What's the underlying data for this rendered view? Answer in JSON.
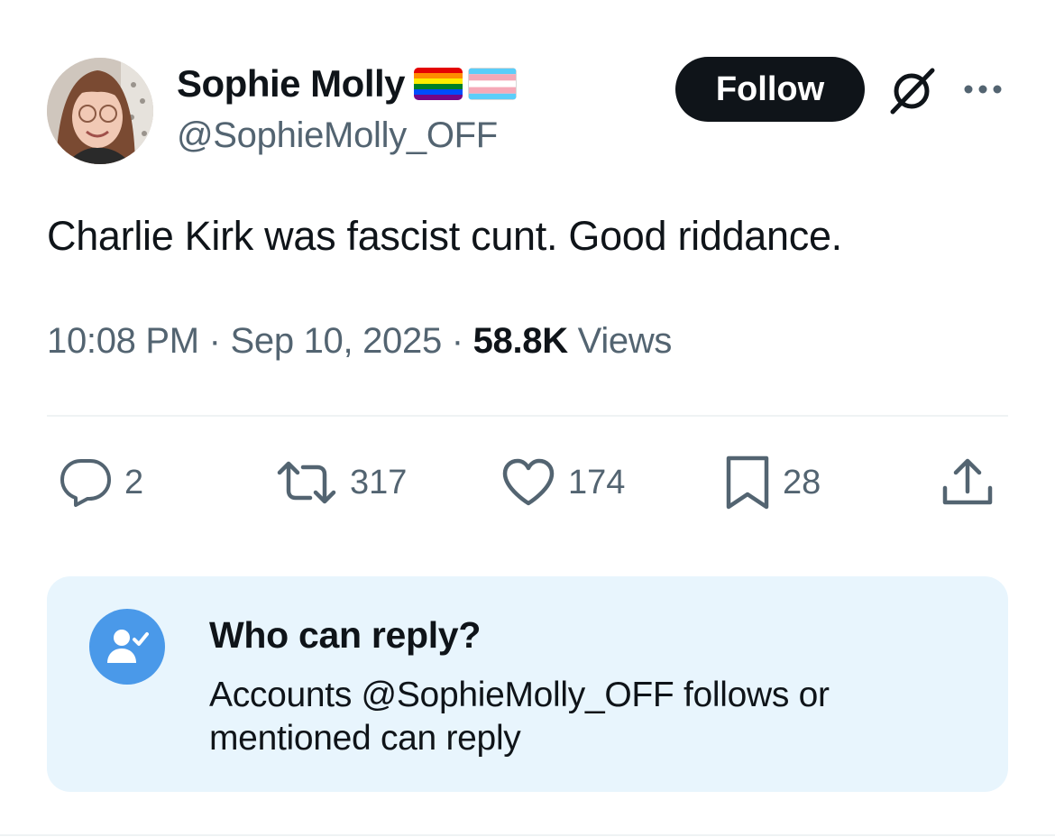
{
  "author": {
    "display_name": "Sophie Molly",
    "handle": "@SophieMolly_OFF",
    "flags": [
      "rainbow-pride-flag-emoji",
      "transgender-flag-emoji"
    ]
  },
  "header": {
    "follow_label": "Follow",
    "grok_icon": "grok-icon",
    "more_icon": "more-horizontal-icon"
  },
  "tweet": {
    "text": "Charlie Kirk was fascist cunt. Good riddance.",
    "time": "10:08 PM",
    "separator": "·",
    "date": "Sep 10, 2025",
    "views_count": "58.8K",
    "views_label": "Views"
  },
  "actions": {
    "replies": "2",
    "reposts": "317",
    "likes": "174",
    "bookmarks": "28"
  },
  "reply_restriction": {
    "title": "Who can reply?",
    "description": "Accounts @SophieMolly_OFF follows or mentioned can reply"
  },
  "colors": {
    "text_primary": "#0f1419",
    "text_secondary": "#536471",
    "follow_bg": "#0f1419",
    "card_bg": "#e8f5fd",
    "badge_bg": "#4a99e9"
  }
}
